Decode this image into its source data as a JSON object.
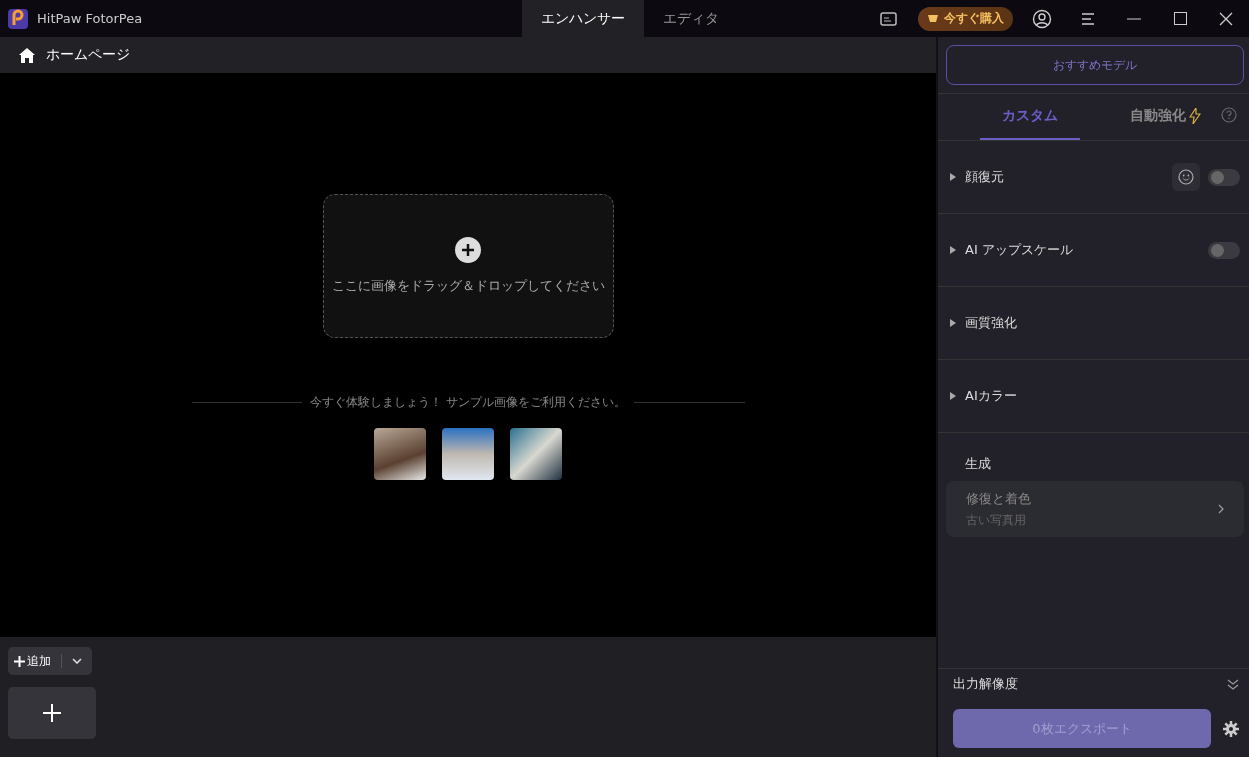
{
  "window": {
    "title": "HitPaw FotorPea"
  },
  "top_tabs": [
    {
      "label": "エンハンサー",
      "selected": true
    },
    {
      "label": "エディタ",
      "selected": false
    }
  ],
  "buy_button": "今すぐ購入",
  "breadcrumb": "ホームページ",
  "dropzone": {
    "text": "ここに画像をドラッグ＆ドロップしてください"
  },
  "sample_hint": "今すぐ体験しましょう！ サンプル画像をご利用ください。",
  "add_button": "追加",
  "side_panel": {
    "recommend_button": "おすすめモデル",
    "mode_tabs": [
      {
        "label": "カスタム",
        "selected": true
      },
      {
        "label": "自動強化",
        "selected": false
      }
    ],
    "sections": [
      {
        "label": "顔復元",
        "kind": "toggle_face",
        "on": false
      },
      {
        "label": "AI アップスケール",
        "kind": "toggle",
        "on": false
      },
      {
        "label": "画質強化",
        "kind": "plain"
      },
      {
        "label": "AIカラー",
        "kind": "plain"
      }
    ],
    "generate_heading": "生成",
    "generate_card": {
      "title": "修復と着色",
      "subtitle": "古い写真用"
    },
    "output_resolution": "出力解像度",
    "export_button": "0枚エクスポート"
  }
}
